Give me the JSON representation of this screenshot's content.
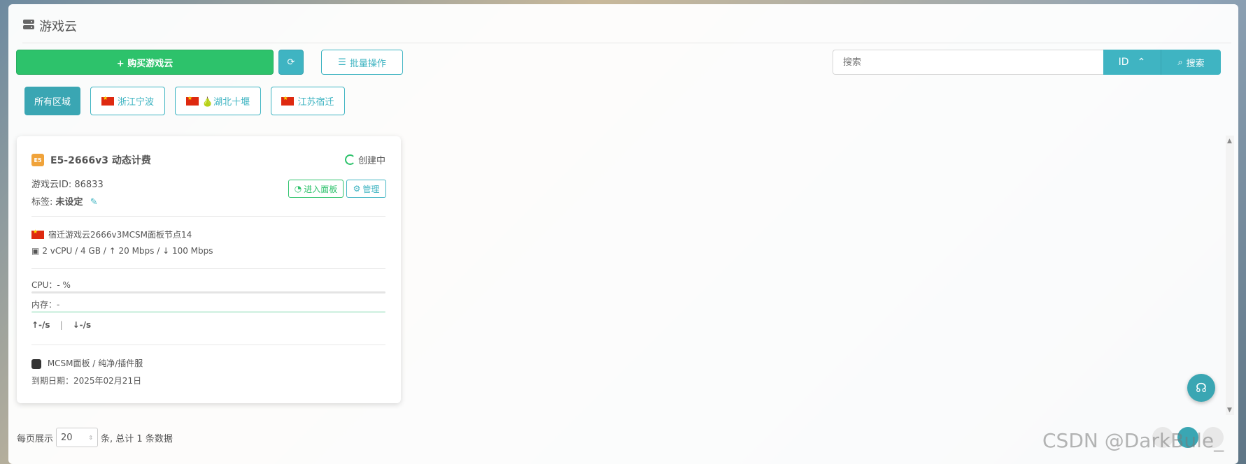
{
  "header": {
    "title": "游戏云",
    "icon": "server-icon"
  },
  "toolbar": {
    "buy_label": "+ 购买游戏云",
    "refresh_icon": "refresh-icon",
    "batch_label": "批量操作",
    "batch_icon": "list-icon"
  },
  "search": {
    "placeholder": "搜索",
    "field": "ID",
    "button_label": "搜索"
  },
  "regions": [
    {
      "label": "所有区域"
    },
    {
      "label": "浙江宁波"
    },
    {
      "label": "🍐湖北十堰"
    },
    {
      "label": "江苏宿迁"
    }
  ],
  "card": {
    "badge": "E5",
    "title": "E5-2666v3 动态计费",
    "status": "创建中",
    "id_line": "游戏云ID: 86833",
    "tag_label": "标签:",
    "tag_value": "未设定",
    "panel_button": "进入面板",
    "manage_button": "管理",
    "node_name": "宿迁游戏云2666v3MCSM面板节点14",
    "specs": "2 vCPU / 4 GB / ↑ 20 Mbps / ↓ 100 Mbps",
    "cpu_label": "CPU：- %",
    "mem_label": "内存：-",
    "net_up": "↑-/s",
    "net_divider": "|",
    "net_down": "↓-/s",
    "panel_type": "MCSM面板 / 纯净/插件服",
    "expiry": "到期日期：2025年02月21日"
  },
  "pager": {
    "prefix": "每页展示",
    "page_size": "20",
    "suffix": "条, 总计 1 条数据"
  },
  "watermark": "CSDN @DarkBule_",
  "colors": {
    "primary": "#3fb4c2",
    "success": "#2dc26b",
    "badge": "#f0a33a"
  }
}
